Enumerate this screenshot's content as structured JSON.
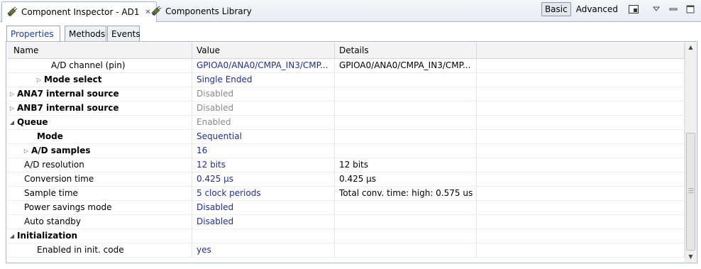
{
  "view_tabs": [
    {
      "label": "Component Inspector - AD1",
      "active": true
    },
    {
      "label": "Components Library",
      "active": false
    }
  ],
  "toolbar": {
    "basic_label": "Basic",
    "advanced_label": "Advanced"
  },
  "sub_tabs": [
    {
      "label": "Properties",
      "active": true
    },
    {
      "label": "Methods",
      "active": false
    },
    {
      "label": "Events",
      "active": false
    }
  ],
  "table": {
    "headers": [
      "Name",
      "Value",
      "Details"
    ],
    "rows": [
      {
        "name": "A/D channel (pin)",
        "value": "GPIOA0/ANA0/CMPA_IN3/CMP...",
        "details": "GPIOA0/ANA0/CMPA_IN3/CMP...",
        "tree": "none",
        "bold": false,
        "value_style": "blue"
      },
      {
        "name": "Mode select",
        "value": "Single Ended",
        "details": "",
        "tree": "collapsed",
        "bold": true,
        "value_style": "blue"
      },
      {
        "name": "ANA7 internal source",
        "value": "Disabled",
        "details": "",
        "tree": "collapsed",
        "bold": true,
        "value_style": "gray"
      },
      {
        "name": "ANB7 internal source",
        "value": "Disabled",
        "details": "",
        "tree": "collapsed",
        "bold": true,
        "value_style": "gray"
      },
      {
        "name": "Queue",
        "value": "Enabled",
        "details": "",
        "tree": "expanded",
        "bold": true,
        "value_style": "gray"
      },
      {
        "name": "Mode",
        "value": "Sequential",
        "details": "",
        "tree": "none",
        "bold": true,
        "value_style": "blue"
      },
      {
        "name": "A/D samples",
        "value": "16",
        "details": "",
        "tree": "collapsed",
        "bold": true,
        "value_style": "blue"
      },
      {
        "name": "A/D resolution",
        "value": "12 bits",
        "details": "12 bits",
        "tree": "none",
        "bold": false,
        "value_style": "blue"
      },
      {
        "name": "Conversion time",
        "value": "0.425 µs",
        "details": "0.425 µs",
        "tree": "none",
        "bold": false,
        "value_style": "blue"
      },
      {
        "name": "Sample time",
        "value": "5 clock periods",
        "details": "Total conv. time:  high: 0.575 us",
        "tree": "none",
        "bold": false,
        "value_style": "blue"
      },
      {
        "name": "Power savings mode",
        "value": "Disabled",
        "details": "",
        "tree": "none",
        "bold": false,
        "value_style": "blue"
      },
      {
        "name": "Auto standby",
        "value": "Disabled",
        "details": "",
        "tree": "none",
        "bold": false,
        "value_style": "blue"
      },
      {
        "name": "Initialization",
        "value": "",
        "details": "",
        "tree": "expanded",
        "bold": true,
        "value_style": "blue"
      },
      {
        "name": "Enabled in init. code",
        "value": "yes",
        "details": "",
        "tree": "none",
        "bold": false,
        "value_style": "blue"
      }
    ]
  },
  "icons": {
    "tab_icon": "plug-icon",
    "close": "close-icon",
    "layout": "layout-icon",
    "menu": "view-menu-icon",
    "minimize": "minimize-icon",
    "maximize": "maximize-icon"
  }
}
